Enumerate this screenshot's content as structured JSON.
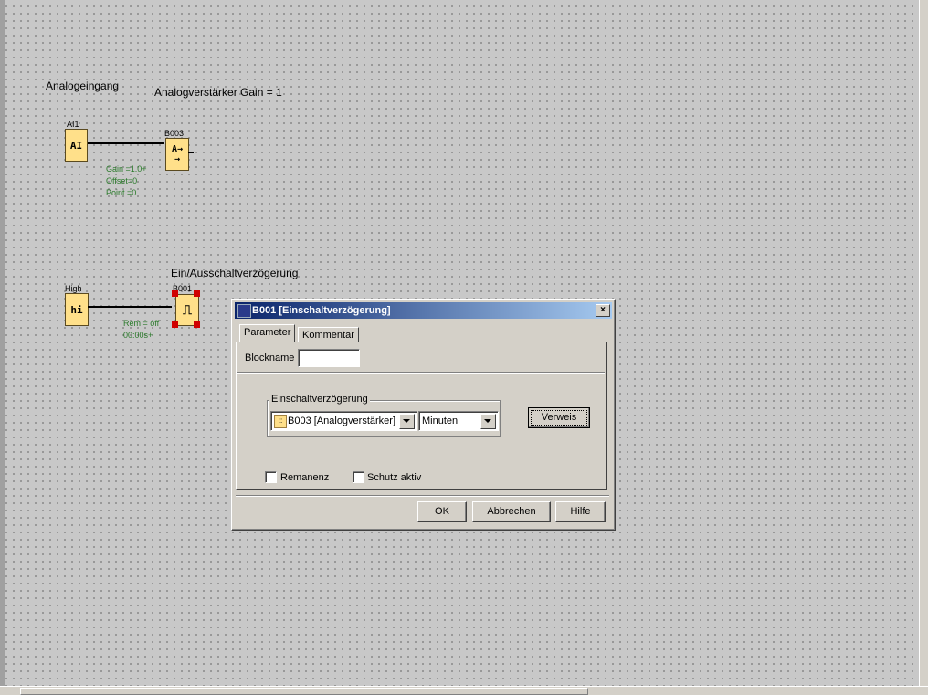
{
  "canvas": {
    "labels": {
      "analog_input_title": "Analogeingang",
      "amplifier_title": "Analogverstärker Gain = 1",
      "delay_title": "Ein/Ausschaltverzögerung"
    },
    "blocks": {
      "ai1": {
        "name": "AI1",
        "symbol": "AI"
      },
      "b003": {
        "name": "B003",
        "symbol": "A→",
        "symbol2": "→"
      },
      "high": {
        "name": "High",
        "symbol": "hi"
      },
      "b001": {
        "name": "B001",
        "symbol": "⎍"
      }
    },
    "b003_params": [
      "Gain =1.0+",
      "Offset=0",
      "Point =0"
    ],
    "b001_params": [
      "Rem = off",
      "00:00s+"
    ]
  },
  "dialog": {
    "title": "B001 [Einschaltverzögerung]",
    "close": "×",
    "tabs": [
      "Parameter",
      "Kommentar"
    ],
    "blockname_label": "Blockname",
    "blockname_value": "",
    "group_title": "Einschaltverzögerung",
    "source_combo": {
      "icon": "::",
      "value": "B003 [Analogverstärker]"
    },
    "unit_combo": {
      "value": "Minuten"
    },
    "verweis_button": "Verweis",
    "retentivity_label": "Remanenz",
    "protection_label": "Schutz aktiv",
    "ok_button": "OK",
    "cancel_button": "Abbrechen",
    "help_button": "Hilfe"
  }
}
